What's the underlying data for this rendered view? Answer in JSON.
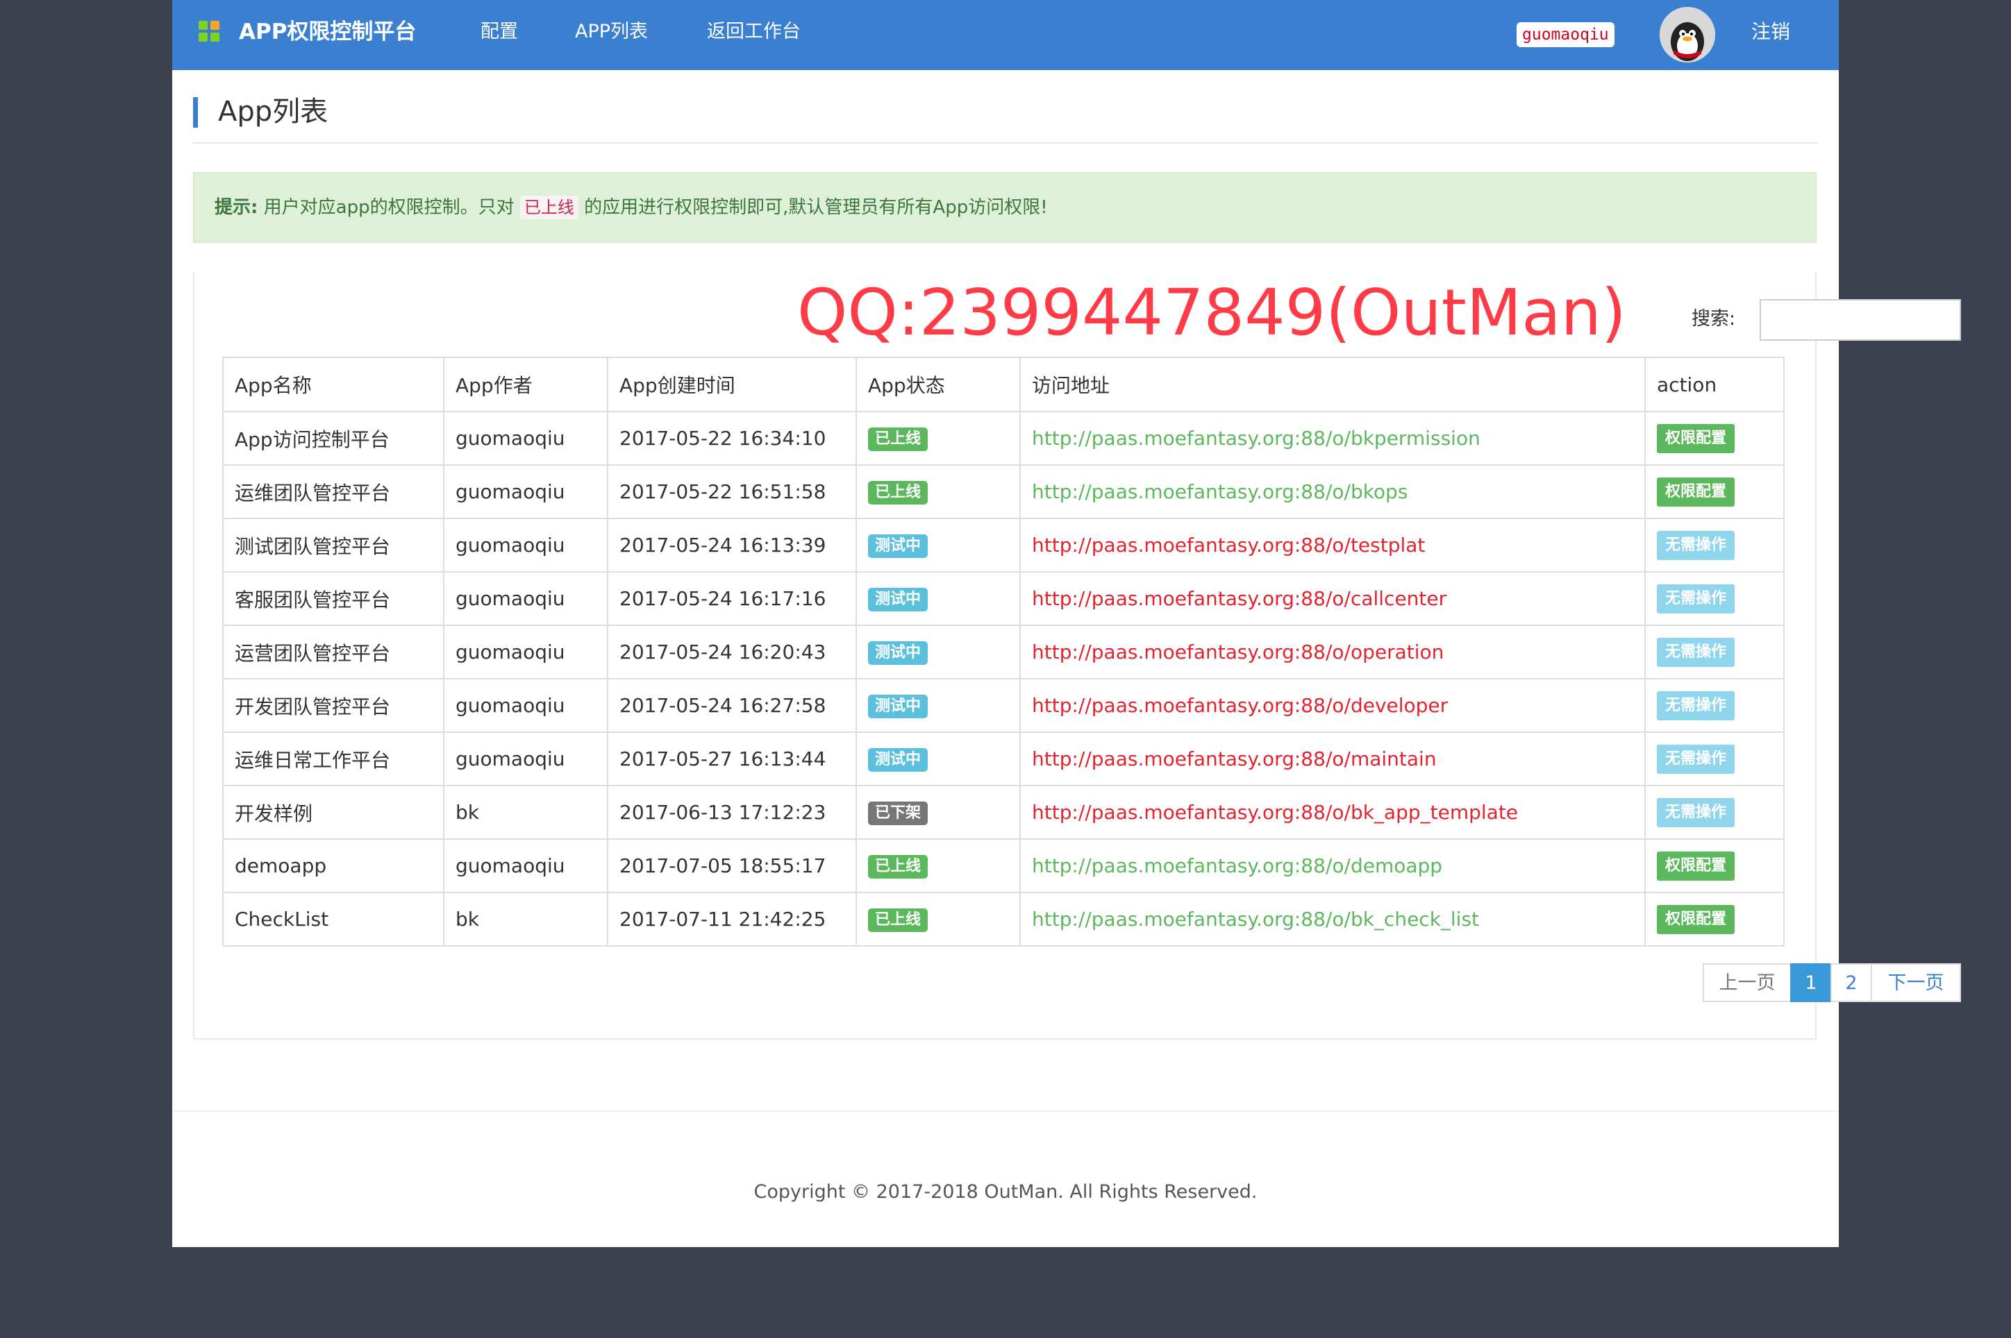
{
  "navbar": {
    "brand": "APP权限控制平台",
    "links": [
      "配置",
      "APP列表",
      "返回工作台"
    ],
    "username": "guomaoqiu",
    "logout": "注销"
  },
  "page_title": "App列表",
  "tip": {
    "label": "提示:",
    "text_before": "用户对应app的权限控制。只对",
    "highlight": "已上线",
    "text_after": "的应用进行权限控制即可,默认管理员有所有App访问权限!"
  },
  "watermark": "QQ:2399447849(OutMan)",
  "search": {
    "label": "搜索:",
    "value": ""
  },
  "table": {
    "headers": [
      "App名称",
      "App作者",
      "App创建时间",
      "App状态",
      "访问地址",
      "action"
    ],
    "rows": [
      {
        "name": "App访问控制平台",
        "author": "guomaoqiu",
        "created": "2017-05-22 16:34:10",
        "status": "已上线",
        "url": "http://paas.moefantasy.org:88/o/bkpermission",
        "action": "权限配置"
      },
      {
        "name": "运维团队管控平台",
        "author": "guomaoqiu",
        "created": "2017-05-22 16:51:58",
        "status": "已上线",
        "url": "http://paas.moefantasy.org:88/o/bkops",
        "action": "权限配置"
      },
      {
        "name": "测试团队管控平台",
        "author": "guomaoqiu",
        "created": "2017-05-24 16:13:39",
        "status": "测试中",
        "url": "http://paas.moefantasy.org:88/o/testplat",
        "action": "无需操作"
      },
      {
        "name": "客服团队管控平台",
        "author": "guomaoqiu",
        "created": "2017-05-24 16:17:16",
        "status": "测试中",
        "url": "http://paas.moefantasy.org:88/o/callcenter",
        "action": "无需操作"
      },
      {
        "name": "运营团队管控平台",
        "author": "guomaoqiu",
        "created": "2017-05-24 16:20:43",
        "status": "测试中",
        "url": "http://paas.moefantasy.org:88/o/operation",
        "action": "无需操作"
      },
      {
        "name": "开发团队管控平台",
        "author": "guomaoqiu",
        "created": "2017-05-24 16:27:58",
        "status": "测试中",
        "url": "http://paas.moefantasy.org:88/o/developer",
        "action": "无需操作"
      },
      {
        "name": "运维日常工作平台",
        "author": "guomaoqiu",
        "created": "2017-05-27 16:13:44",
        "status": "测试中",
        "url": "http://paas.moefantasy.org:88/o/maintain",
        "action": "无需操作"
      },
      {
        "name": "开发样例",
        "author": "bk",
        "created": "2017-06-13 17:12:23",
        "status": "已下架",
        "url": "http://paas.moefantasy.org:88/o/bk_app_template",
        "action": "无需操作"
      },
      {
        "name": "demoapp",
        "author": "guomaoqiu",
        "created": "2017-07-05 18:55:17",
        "status": "已上线",
        "url": "http://paas.moefantasy.org:88/o/demoapp",
        "action": "权限配置"
      },
      {
        "name": "CheckList",
        "author": "bk",
        "created": "2017-07-11 21:42:25",
        "status": "已上线",
        "url": "http://paas.moefantasy.org:88/o/bk_check_list",
        "action": "权限配置"
      }
    ]
  },
  "status_colors": {
    "已上线": "#5cb85c",
    "测试中": "#5bc0de",
    "已下架": "#777777"
  },
  "pagination": {
    "prev": "上一页",
    "pages": [
      "1",
      "2"
    ],
    "current": "1",
    "next": "下一页"
  },
  "footer": "Copyright © 2017-2018 OutMan. All Rights Reserved."
}
